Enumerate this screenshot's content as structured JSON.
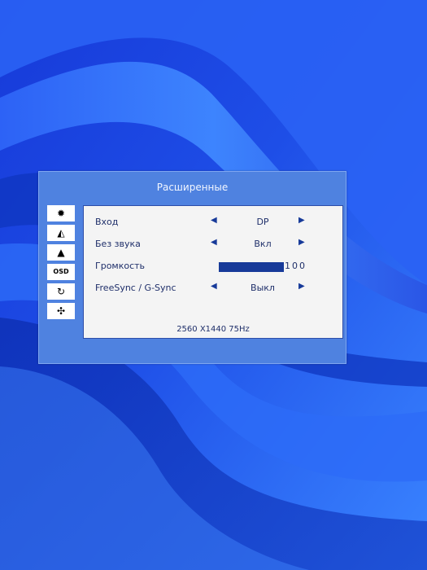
{
  "osd": {
    "title": "Расширенные",
    "menu_icons": [
      {
        "name": "brightness-icon",
        "active": true,
        "glyph": "✹"
      },
      {
        "name": "image-icon",
        "active": true,
        "glyph": "◭"
      },
      {
        "name": "color-icon",
        "active": true,
        "glyph": "▲"
      },
      {
        "name": "osd-settings-icon",
        "active": true,
        "glyph": "OSD"
      },
      {
        "name": "reset-icon",
        "active": true,
        "glyph": "↻"
      },
      {
        "name": "advanced-icon",
        "active": true,
        "glyph": "✣"
      }
    ],
    "rows": [
      {
        "label": "Вход",
        "value": "DP"
      },
      {
        "label": "Без звука",
        "value": "Вкл"
      },
      {
        "label": "Громкость",
        "value": "100",
        "volume_level": 100
      },
      {
        "label": "FreeSync / G-Sync",
        "value": "Выкл"
      }
    ],
    "status": {
      "resolution": "2560 X 1440",
      "refresh_rate": "75Hz",
      "display_text": "2560 X1440 75Hz"
    }
  }
}
